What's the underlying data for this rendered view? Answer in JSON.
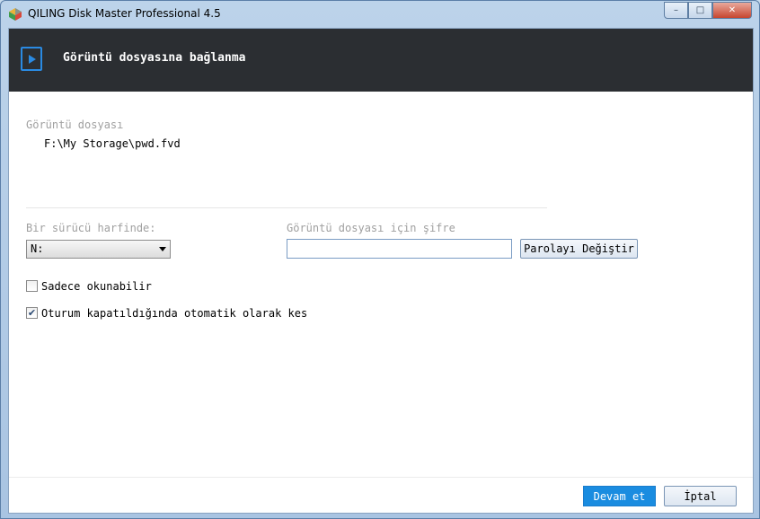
{
  "window": {
    "title": "QILING Disk Master Professional 4.5",
    "minimize_glyph": "–",
    "maximize_glyph": "□",
    "close_glyph": "✕"
  },
  "header": {
    "icon": "play-icon",
    "title": "Görüntü dosyasına bağlanma"
  },
  "image_file": {
    "label": "Görüntü dosyası",
    "path": "F:\\My Storage\\pwd.fvd"
  },
  "drive_letter": {
    "label": "Bir sürücü harfinde:",
    "selected": "N:"
  },
  "password": {
    "label": "Görüntü dosyası için şifre",
    "value": "",
    "change_button": "Parolayı Değiştir"
  },
  "options": {
    "read_only": {
      "label": "Sadece okunabilir",
      "checked": false
    },
    "auto_detach": {
      "label": "Oturum kapatıldığında otomatik olarak kes",
      "checked": true
    }
  },
  "footer": {
    "continue_button": "Devam et",
    "cancel_button": "İptal"
  },
  "colors": {
    "header_bg": "#2b2e32",
    "accent": "#1a8ce0"
  }
}
